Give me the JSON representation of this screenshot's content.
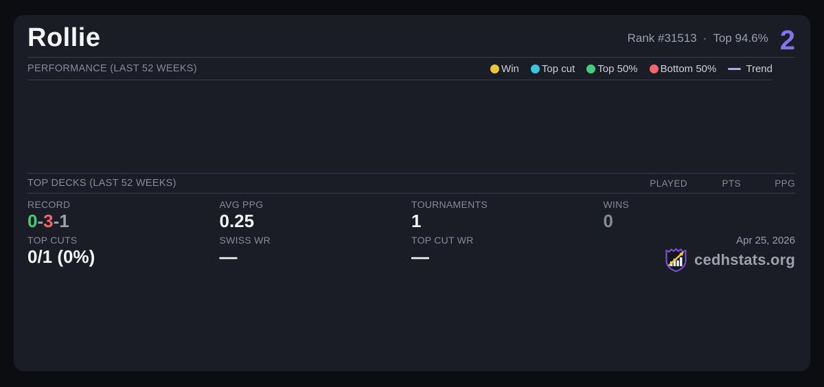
{
  "colors": {
    "page_bg": "#0c0d11",
    "card_bg": "#1a1c26",
    "divider": "#363d4e",
    "accent_purple": "#8573ee",
    "trend_purple": "#b3a5f6",
    "win_yellow": "#eec53a",
    "topcut_cyan": "#38c6e5",
    "top50_green": "#41cf7c",
    "bottom50_red": "#f1666e",
    "record_green": "#41cf6f",
    "record_red": "#f0656f",
    "record_muted": "#9aa1ae",
    "muted_value": "#848b97",
    "label_gray": "#848b9b",
    "legend_text": "#ccd0d8",
    "rank_text": "#98a0b0",
    "brand_purple": "#7a4fd0",
    "arrow_yellow": "#f0c83c"
  },
  "header": {
    "player_name": "Rollie",
    "rank": "Rank #31513",
    "separator": "·",
    "top_percent": "Top 94.6%",
    "big_number": "2"
  },
  "performance": {
    "title": "PERFORMANCE (LAST 52 WEEKS)",
    "legend_labels": [
      "Win",
      "Top cut",
      "Top 50%",
      "Bottom 50%",
      "Trend"
    ]
  },
  "chart_data": {
    "type": "scatter",
    "title": "PERFORMANCE (LAST 52 WEEKS)",
    "series": [],
    "note": "chart area is empty - no data points plotted"
  },
  "top_decks": {
    "title": "TOP DECKS (LAST 52 WEEKS)",
    "columns": [
      "PLAYED",
      "PTS",
      "PPG"
    ],
    "rows": []
  },
  "stats": {
    "record": {
      "label": "RECORD",
      "wins": "0",
      "losses": "3",
      "draws": "1",
      "separator": "-"
    },
    "avg_ppg": {
      "label": "AVG PPG",
      "value": "0.25"
    },
    "tournaments": {
      "label": "TOURNAMENTS",
      "value": "1"
    },
    "wins": {
      "label": "WINS",
      "value": "0"
    },
    "top_cuts": {
      "label": "TOP CUTS",
      "value": "0/1 (0%)"
    },
    "swiss_wr": {
      "label": "SWISS WR",
      "value": "—"
    },
    "top_cut_wr": {
      "label": "TOP CUT WR",
      "value": "—"
    }
  },
  "footer": {
    "date": "Apr 25, 2026",
    "site": "cedhstats.org"
  }
}
